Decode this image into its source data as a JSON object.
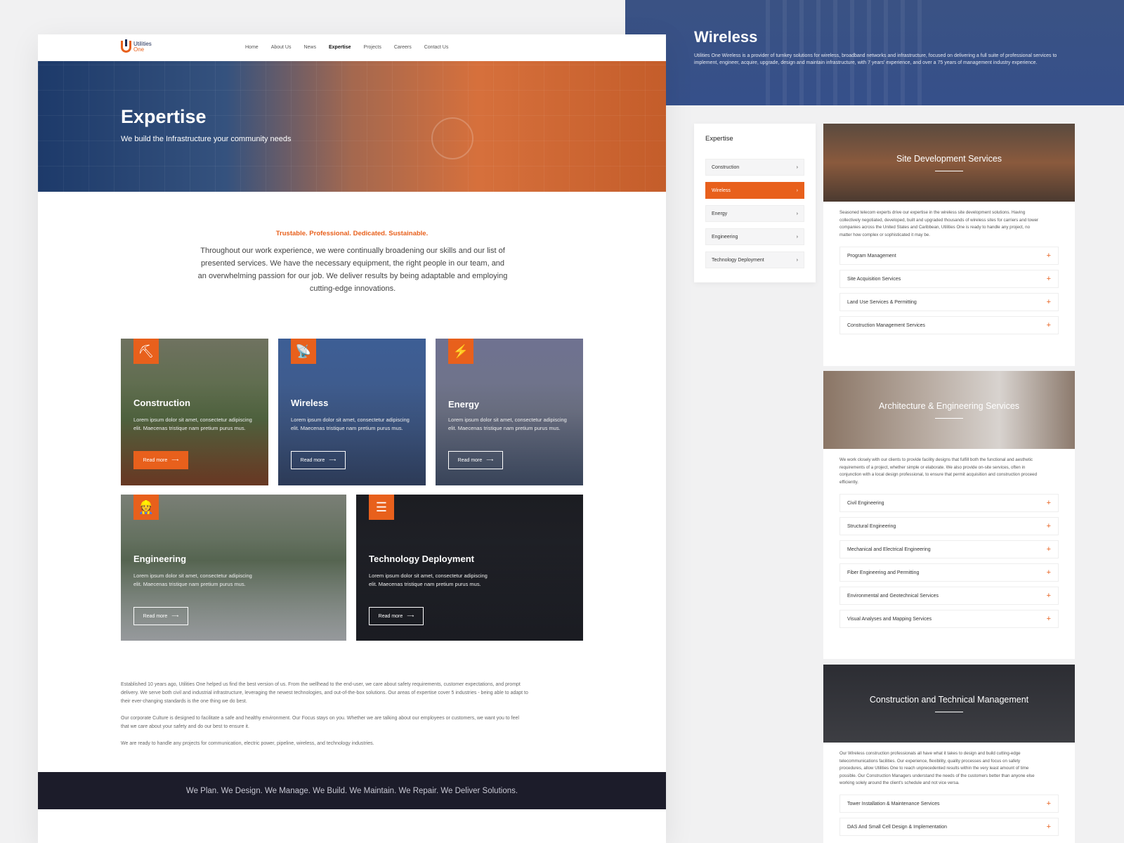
{
  "left": {
    "logo": {
      "line1": "Utilities",
      "line2": "One"
    },
    "nav": [
      "Home",
      "About Us",
      "News",
      "Expertise",
      "Projects",
      "Careers",
      "Contact Us"
    ],
    "hero": {
      "title": "Expertise",
      "subtitle": "We build the Infrastructure your community needs"
    },
    "tagline": "Trustable. Professional. Dedicated. Sustainable.",
    "intro": "Throughout our work experience, we were continually broadening our skills and our list of presented services. We have the necessary equipment, the right people in our team, and an overwhelming passion for our job. We deliver results by being adaptable and employing cutting-edge innovations.",
    "cards": [
      {
        "title": "Construction",
        "text": "Lorem ipsum dolor sit amet, consectetur adipiscing elit. Maecenas tristique nam pretium purus mus.",
        "button": "Read more",
        "icon": "excavator-icon"
      },
      {
        "title": "Wireless",
        "text": "Lorem ipsum dolor sit amet, consectetur adipiscing elit. Maecenas tristique nam pretium purus mus.",
        "button": "Read more",
        "icon": "antenna-icon"
      },
      {
        "title": "Energy",
        "text": "Lorem ipsum dolor sit amet, consectetur adipiscing elit. Maecenas tristique nam pretium purus mus.",
        "button": "Read more",
        "icon": "windmill-icon"
      },
      {
        "title": "Engineering",
        "text": "Lorem ipsum dolor sit amet, consectetur adipiscing elit. Maecenas tristique nam pretium purus mus.",
        "button": "Read more",
        "icon": "engineer-icon"
      },
      {
        "title": "Technology Deployment",
        "text": "Lorem ipsum dolor sit amet, consectetur adipiscing elit. Maecenas tristique nam pretium purus mus.",
        "button": "Read more",
        "icon": "server-icon"
      }
    ],
    "paragraphs": [
      "Established 10 years ago, Utilities One helped us find the best version of us. From the wellhead to the end-user, we care about safety requirements, customer expectations, and prompt delivery. We serve both civil and industrial infrastructure, leveraging the newest technologies, and out-of-the-box solutions. Our areas of expertise cover 5 industries - being able to adapt to their ever-changing standards is the one thing we do best.",
      "Our corporate Culture is designed to facilitate a safe and healthy environment. Our Focus stays on you. Whether we are talking about our employees or customers, we want you to feel that we care about your safety and do our best to ensure it.",
      "We are ready to handle any projects for communication, electric power, pipeline, wireless, and technology industries."
    ],
    "footer_band": "We Plan. We Design. We Manage. We Build. We Maintain. We Repair. We Deliver Solutions."
  },
  "right": {
    "hero": {
      "title": "Wireless",
      "text": "Utilities One Wireless is a provider of turnkey solutions for wireless, broadband networks and infrastructure, focused on delivering a full suite of professional services to implement, engineer, acquire, upgrade, design and maintain infrastructure, with 7 years' experience, and over a 75 years of management industry experience."
    },
    "sidebar": {
      "title": "Expertise",
      "items": [
        "Construction",
        "Wireless",
        "Energy",
        "Engineering",
        "Technology Deployment"
      ],
      "active": "Wireless"
    },
    "panels": [
      {
        "title": "Site Development Services",
        "text": "Seasoned telecom experts drive our expertise in the wireless site development solutions. Having collectively negotiated, developed, built and upgraded thousands of wireless sites for carriers and tower companies across the United States and Caribbean, Utilities One is ready to handle any project, no matter how complex or sophisticated it may be.",
        "items": [
          "Program Management",
          "Site Acquisition Services",
          "Land Use Services & Permitting",
          "Construction Management Services"
        ]
      },
      {
        "title": "Architecture & Engineering Services",
        "text": "We work closely with our clients to provide facility designs that fulfill both the functional and aesthetic requirements of a project, whether simple or elaborate. We also provide on-site services, often in conjunction with a local design professional, to ensure that permit acquisition and construction proceed efficiently.",
        "items": [
          "Civil Engineering",
          "Structural Engineering",
          "Mechanical and Electrical Engineering",
          "Fiber Engineering and Permitting",
          "Environmental and Geotechnical Services",
          "Visual Analyses and Mapping Services"
        ]
      },
      {
        "title": "Construction and Technical Management",
        "text": "Our Wireless construction professionals all have what it takes to design and build cutting-edge telecommunications facilities. Our experience, flexibility, quality processes and focus on safety procedures, allow Utilities One to reach unprecedented results within the very least amount of time possible. Our Construction Managers understand the needs of the customers better than anyone else working solely around the client's schedule and not vice versa.",
        "items": [
          "Tower Installation & Maintenance Services",
          "DAS And Small Cell Design & Implementation"
        ]
      }
    ]
  },
  "colors": {
    "accent": "#e8601c",
    "navy": "#1c2b54",
    "dark_band": "#1c1c2a"
  }
}
